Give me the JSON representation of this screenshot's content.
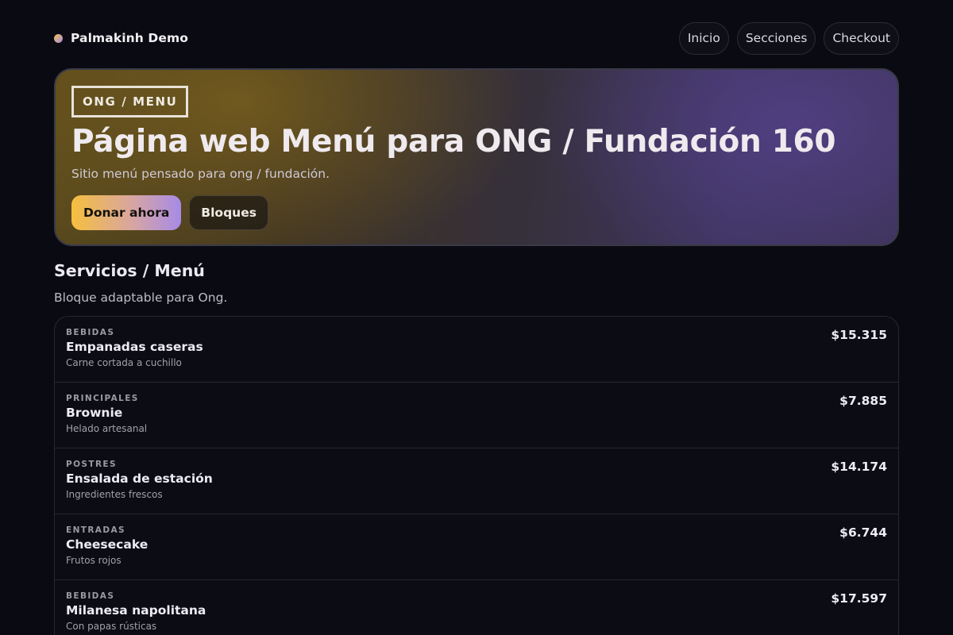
{
  "header": {
    "brand": "Palmakinh Demo",
    "nav": [
      "Inicio",
      "Secciones",
      "Checkout"
    ]
  },
  "hero": {
    "badge": "ONG / MENU",
    "title": "Página web Menú para ONG / Fundación 160",
    "subtitle": "Sitio menú pensado para ong / fundación.",
    "primary_button": "Donar ahora",
    "secondary_button": "Bloques"
  },
  "section": {
    "title": "Servicios / Menú",
    "subtitle": "Bloque adaptable para Ong."
  },
  "menu": [
    {
      "category": "BEBIDAS",
      "name": "Empanadas caseras",
      "description": "Carne cortada a cuchillo",
      "price": "$15.315"
    },
    {
      "category": "PRINCIPALES",
      "name": "Brownie",
      "description": "Helado artesanal",
      "price": "$7.885"
    },
    {
      "category": "POSTRES",
      "name": "Ensalada de estación",
      "description": "Ingredientes frescos",
      "price": "$14.174"
    },
    {
      "category": "ENTRADAS",
      "name": "Cheesecake",
      "description": "Frutos rojos",
      "price": "$6.744"
    },
    {
      "category": "BEBIDAS",
      "name": "Milanesa napolitana",
      "description": "Con papas rústicas",
      "price": "$17.597"
    }
  ],
  "colors": {
    "background": "#0a0b12",
    "accent_gold": "#f6bf3e",
    "accent_purple": "#a68ae8"
  }
}
